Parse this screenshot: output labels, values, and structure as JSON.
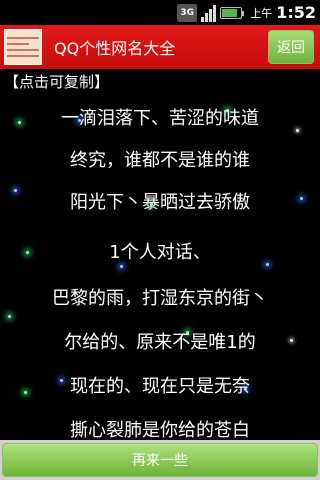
{
  "status_bar": {
    "network": "3G",
    "battery_label": "",
    "ampm": "上午",
    "time": "1:52"
  },
  "header": {
    "title": "QQ个性网名大全",
    "back_label": "返回"
  },
  "hint": "【点击可复制】",
  "names": [
    "一滴泪落下、苦涩的味道",
    "终究，谁都不是谁的谁",
    "阳光下丶暴晒过去骄傲",
    "1个人对话、",
    "巴黎的雨，打湿东京的街丶",
    "尔给的、原来不是唯1的",
    "现在的、现在只是无奈",
    "撕心裂肺是你给的苍白"
  ],
  "footer": {
    "again_label": "再来一些"
  }
}
